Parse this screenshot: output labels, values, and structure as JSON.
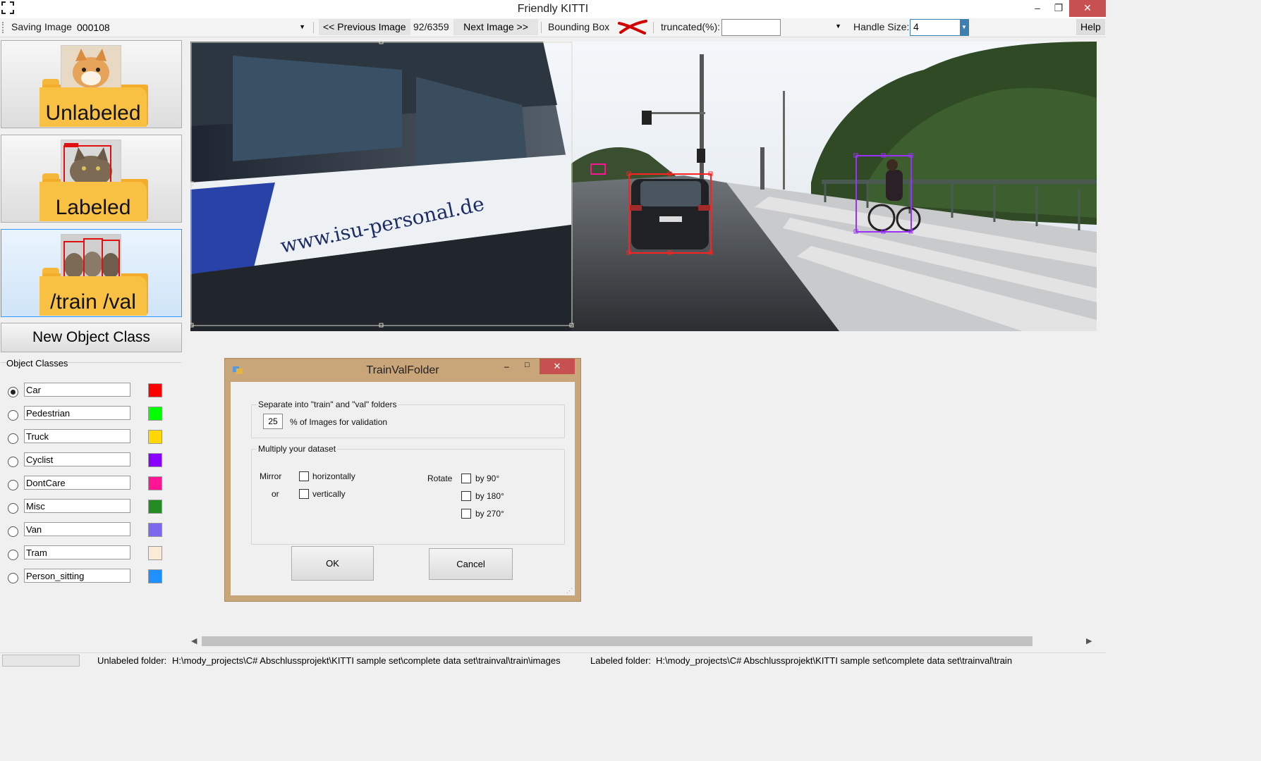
{
  "window": {
    "title": "Friendly KITTI",
    "minimize": "–",
    "restore": "❐",
    "close": "✕"
  },
  "toolbar": {
    "saving": "Saving",
    "image_label": "Image",
    "image_value": "000108",
    "prev_button": "<< Previous Image",
    "counter": "92/6359",
    "next_button": "Next Image >>",
    "bbox_label": "Bounding Box",
    "truncated_label": "truncated(%):",
    "truncated_value": "",
    "handle_size_label": "Handle Size:",
    "handle_size_value": "4",
    "help": "Help"
  },
  "left_panel": {
    "folders": [
      {
        "label": "Unlabeled"
      },
      {
        "label": "Labeled"
      },
      {
        "label": "/train /val"
      }
    ],
    "new_class_button": "New Object Class",
    "classes_title": "Object Classes",
    "classes": [
      {
        "name": "Car",
        "color": "#ff0000",
        "selected": true
      },
      {
        "name": "Pedestrian",
        "color": "#00ff00",
        "selected": false
      },
      {
        "name": "Truck",
        "color": "#ffd700",
        "selected": false
      },
      {
        "name": "Cyclist",
        "color": "#8a00ff",
        "selected": false
      },
      {
        "name": "DontCare",
        "color": "#ff1493",
        "selected": false
      },
      {
        "name": "Misc",
        "color": "#228b22",
        "selected": false
      },
      {
        "name": "Van",
        "color": "#7b68ee",
        "selected": false
      },
      {
        "name": "Tram",
        "color": "#faebd7",
        "selected": false
      },
      {
        "name": "Person_sitting",
        "color": "#1e90ff",
        "selected": false
      }
    ]
  },
  "image_view": {
    "tram_text": "www.isu-personal.de",
    "boxes": [
      {
        "class": "Car",
        "color": "#ff2020"
      },
      {
        "class": "Cyclist",
        "color": "#9b30ff"
      },
      {
        "class": "DontCare",
        "color": "#ff1493"
      }
    ]
  },
  "dialog": {
    "title": "TrainValFolder",
    "group1_title": "Separate into \"train\" and \"val\" folders",
    "val_percent": "25",
    "val_label": "% of Images for validation",
    "group2_title": "Multiply your dataset",
    "mirror_label": "Mirror",
    "or_label": "or",
    "horizontally": "horizontally",
    "vertically": "vertically",
    "rotate_label": "Rotate",
    "by90": "by 90°",
    "by180": "by 180°",
    "by270": "by 270°",
    "ok": "OK",
    "cancel": "Cancel"
  },
  "statusbar": {
    "unlabeled_label": "Unlabeled folder:",
    "unlabeled_path": "H:\\mody_projects\\C# Abschlussprojekt\\KITTI sample set\\complete data set\\trainval\\train\\images",
    "labeled_label": "Labeled folder:",
    "labeled_path": "H:\\mody_projects\\C# Abschlussprojekt\\KITTI sample set\\complete data set\\trainval\\train"
  }
}
